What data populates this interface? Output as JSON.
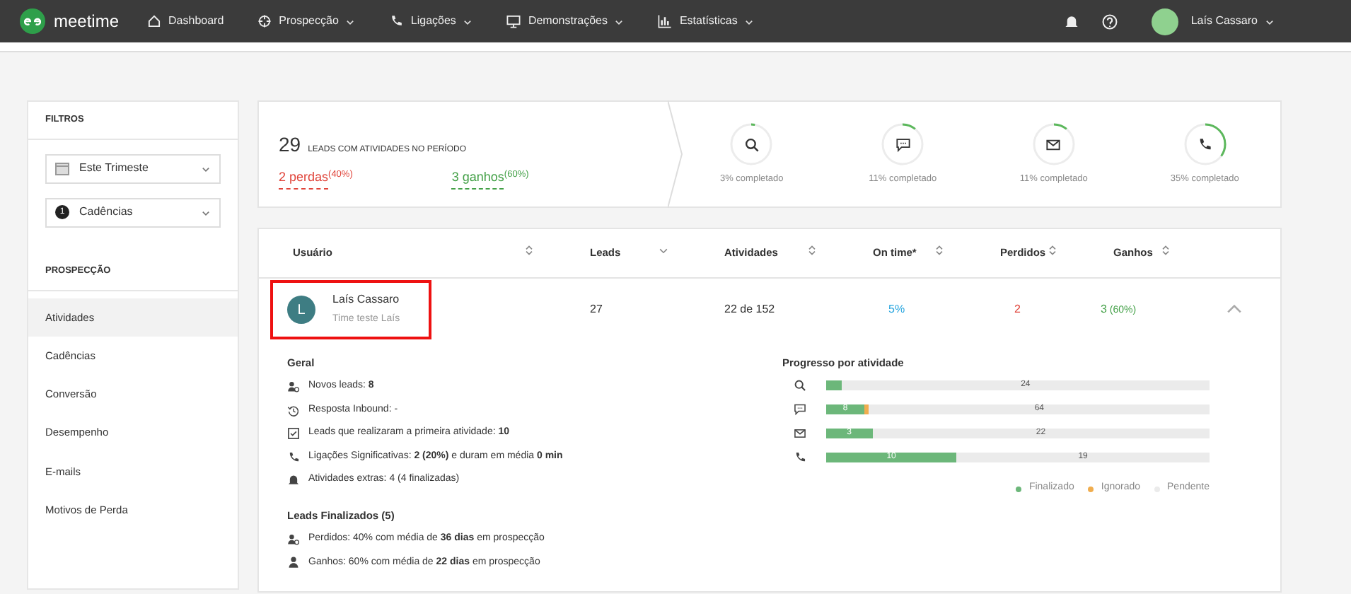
{
  "navbar": {
    "logo_text": "meetime",
    "items": [
      {
        "kind": "home",
        "label": "Dashboard",
        "dropdown": false
      },
      {
        "kind": "target",
        "label": "Prospecção",
        "dropdown": true
      },
      {
        "kind": "phone",
        "label": "Ligações",
        "dropdown": true
      },
      {
        "kind": "monitor",
        "label": "Demonstrações",
        "dropdown": true
      },
      {
        "kind": "chart",
        "label": "Estatísticas",
        "dropdown": true
      }
    ],
    "user": {
      "name": "Laís Cassaro"
    }
  },
  "sidebar": {
    "filters_title": "FILTROS",
    "filters": [
      {
        "kind": "date",
        "value": "Este Trimeste"
      },
      {
        "kind": "count",
        "badge": "1",
        "value": "Cadências"
      }
    ],
    "section_title": "PROSPECÇÃO",
    "items": [
      {
        "label": "Atividades",
        "selected": true
      },
      {
        "label": "Cadências",
        "selected": false
      },
      {
        "label": "Conversão",
        "selected": false
      },
      {
        "label": "Desempenho",
        "selected": false
      },
      {
        "label": "E-mails",
        "selected": false
      },
      {
        "label": "Motivos de Perda",
        "selected": false
      }
    ]
  },
  "summary": {
    "total": "29",
    "total_label": "LEADS COM ATIVIDADES NO PERÍODO",
    "lost": "2 perdas",
    "lost_pct": "(40%)",
    "won": "3 ganhos",
    "won_pct": "(60%)",
    "rings": [
      {
        "kind": "search",
        "level": 0.03,
        "caption": "3% completado"
      },
      {
        "kind": "chat",
        "level": 0.11,
        "caption": "11% completado"
      },
      {
        "kind": "mail",
        "level": 0.11,
        "caption": "11% completado"
      },
      {
        "kind": "phone",
        "level": 0.35,
        "caption": "35% completado"
      }
    ]
  },
  "table": {
    "columns": [
      {
        "label": "Usuário",
        "sorted": false
      },
      {
        "label": "Leads",
        "sorted": true
      },
      {
        "label": "Atividades",
        "sorted": false
      },
      {
        "label": "On time*",
        "sorted": false
      },
      {
        "label": "Perdidos",
        "sorted": false
      },
      {
        "label": "Ganhos",
        "sorted": false
      }
    ],
    "rows": [
      {
        "avatar_letter": "L",
        "name": "Laís Cassaro",
        "team": "Time teste Laís",
        "highlighted": true,
        "leads": "27",
        "activities": "22 de 152",
        "on_time": "5%",
        "lost": "2",
        "won": "3",
        "won_pct": "(60%)",
        "expanded": true
      }
    ]
  },
  "details": {
    "general_title": "Geral",
    "general": [
      {
        "kind": "user-add",
        "text": "Novos leads: **8**"
      },
      {
        "kind": "history",
        "text": "Resposta Inbound: -"
      },
      {
        "kind": "check-square",
        "text": "Leads que realizaram a primeira atividade: **10**"
      },
      {
        "kind": "phone",
        "text": "Ligações Significativas: **2 (20%)** e duram em média **0 min**"
      },
      {
        "kind": "bell",
        "text": "Atividades extras: 4 (4 finalizadas)"
      }
    ],
    "finished_title": "Leads Finalizados (5)",
    "finished": [
      {
        "kind": "user-add",
        "text": "Perdidos: 40% com média de **36 dias** em prospecção"
      },
      {
        "kind": "user",
        "text": "Ganhos: 60% com média de **22 dias** em prospecção"
      }
    ],
    "progress": {
      "title": "Progresso por atividade",
      "rows": [
        {
          "kind": "search",
          "segments": [
            {
              "kind": "done",
              "level": 0.04
            },
            {
              "kind": "pending",
              "level": 0.96,
              "label": "24"
            }
          ]
        },
        {
          "kind": "chat",
          "segments": [
            {
              "kind": "done",
              "level": 0.1,
              "label": "8"
            },
            {
              "kind": "ignored",
              "level": 0.012
            },
            {
              "kind": "pending",
              "level": 0.888,
              "label": "64"
            }
          ]
        },
        {
          "kind": "mail",
          "segments": [
            {
              "kind": "done",
              "level": 0.12,
              "label": "3"
            },
            {
              "kind": "pending",
              "level": 0.88,
              "label": "22"
            }
          ]
        },
        {
          "kind": "phone",
          "segments": [
            {
              "kind": "done",
              "level": 0.34,
              "label": "10"
            },
            {
              "kind": "pending",
              "level": 0.66,
              "label": "19"
            }
          ]
        }
      ],
      "legend": [
        {
          "kind": "done",
          "label": "Finalizado"
        },
        {
          "kind": "ignored",
          "label": "Ignorado"
        },
        {
          "kind": "pending",
          "label": "Pendente"
        }
      ]
    }
  }
}
